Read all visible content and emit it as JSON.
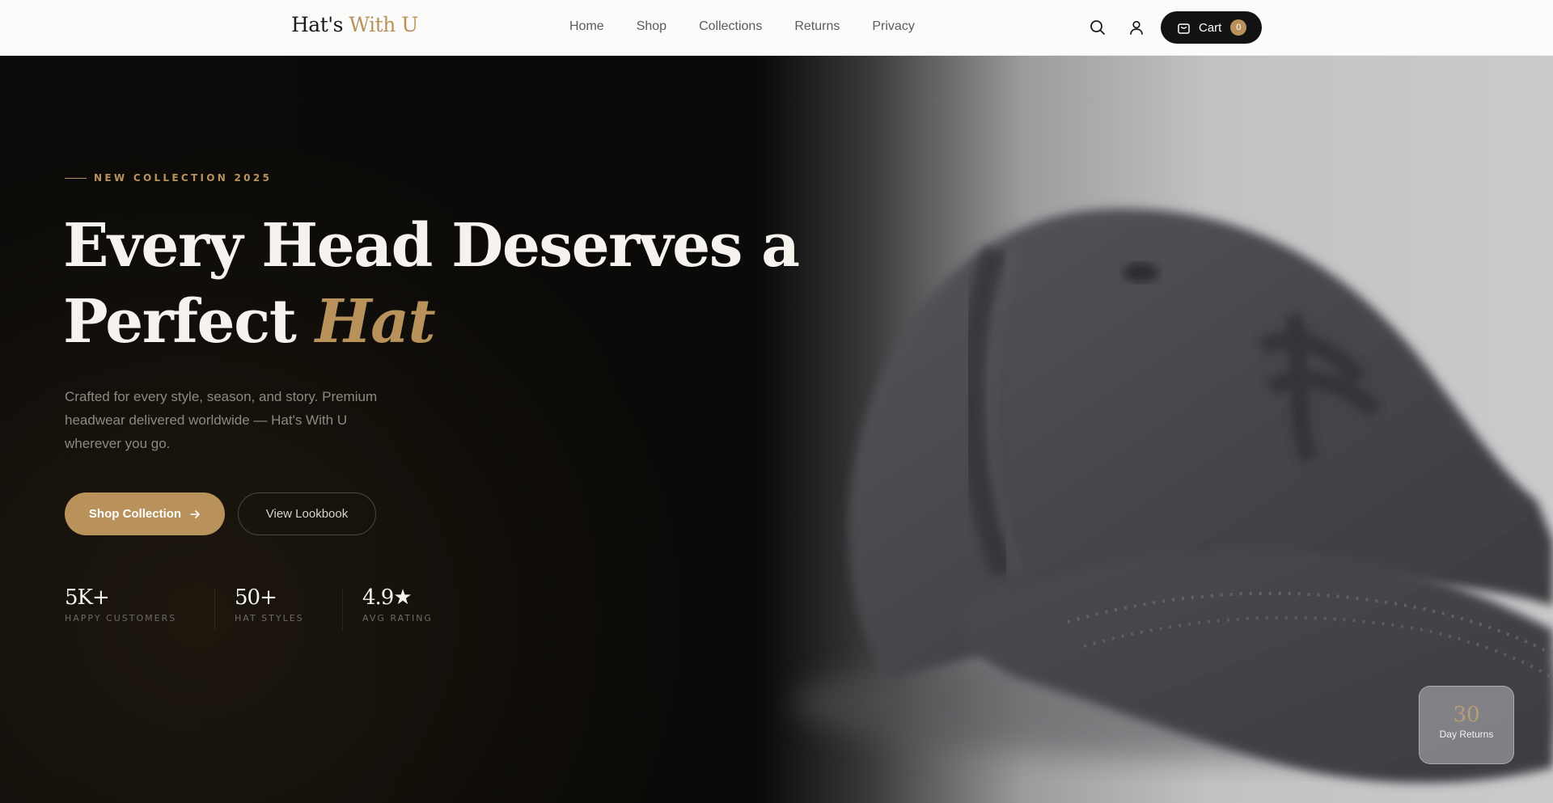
{
  "brand": {
    "name_main": "Hat's",
    "name_accent": "With U"
  },
  "nav": {
    "links": [
      "Home",
      "Shop",
      "Collections",
      "Returns",
      "Privacy"
    ]
  },
  "header": {
    "cart_label": "Cart",
    "cart_count": "0",
    "icons": [
      "search-icon",
      "user-icon",
      "bag-icon"
    ]
  },
  "hero": {
    "eyebrow": "NEW COLLECTION 2025",
    "headline_line1": "Every Head Deserves a",
    "headline_line2": "Perfect",
    "headline_accent": "Hat",
    "subtitle": "Crafted for every style, season, and story. Premium headwear delivered worldwide — Hat's With U wherever you go.",
    "primary_cta": "Shop Collection",
    "secondary_cta": "View Lookbook",
    "stats": [
      {
        "value": "5K+",
        "label": "HAPPY CUSTOMERS"
      },
      {
        "value": "50+",
        "label": "HAT STYLES"
      },
      {
        "value": "4.9★",
        "label": "AVG RATING"
      }
    ],
    "badge": {
      "value": "30",
      "label": "Day Returns"
    }
  },
  "colors": {
    "accent": "#b8925a",
    "dark": "#0b0a08",
    "nav_bg": "#fbfbfa"
  }
}
